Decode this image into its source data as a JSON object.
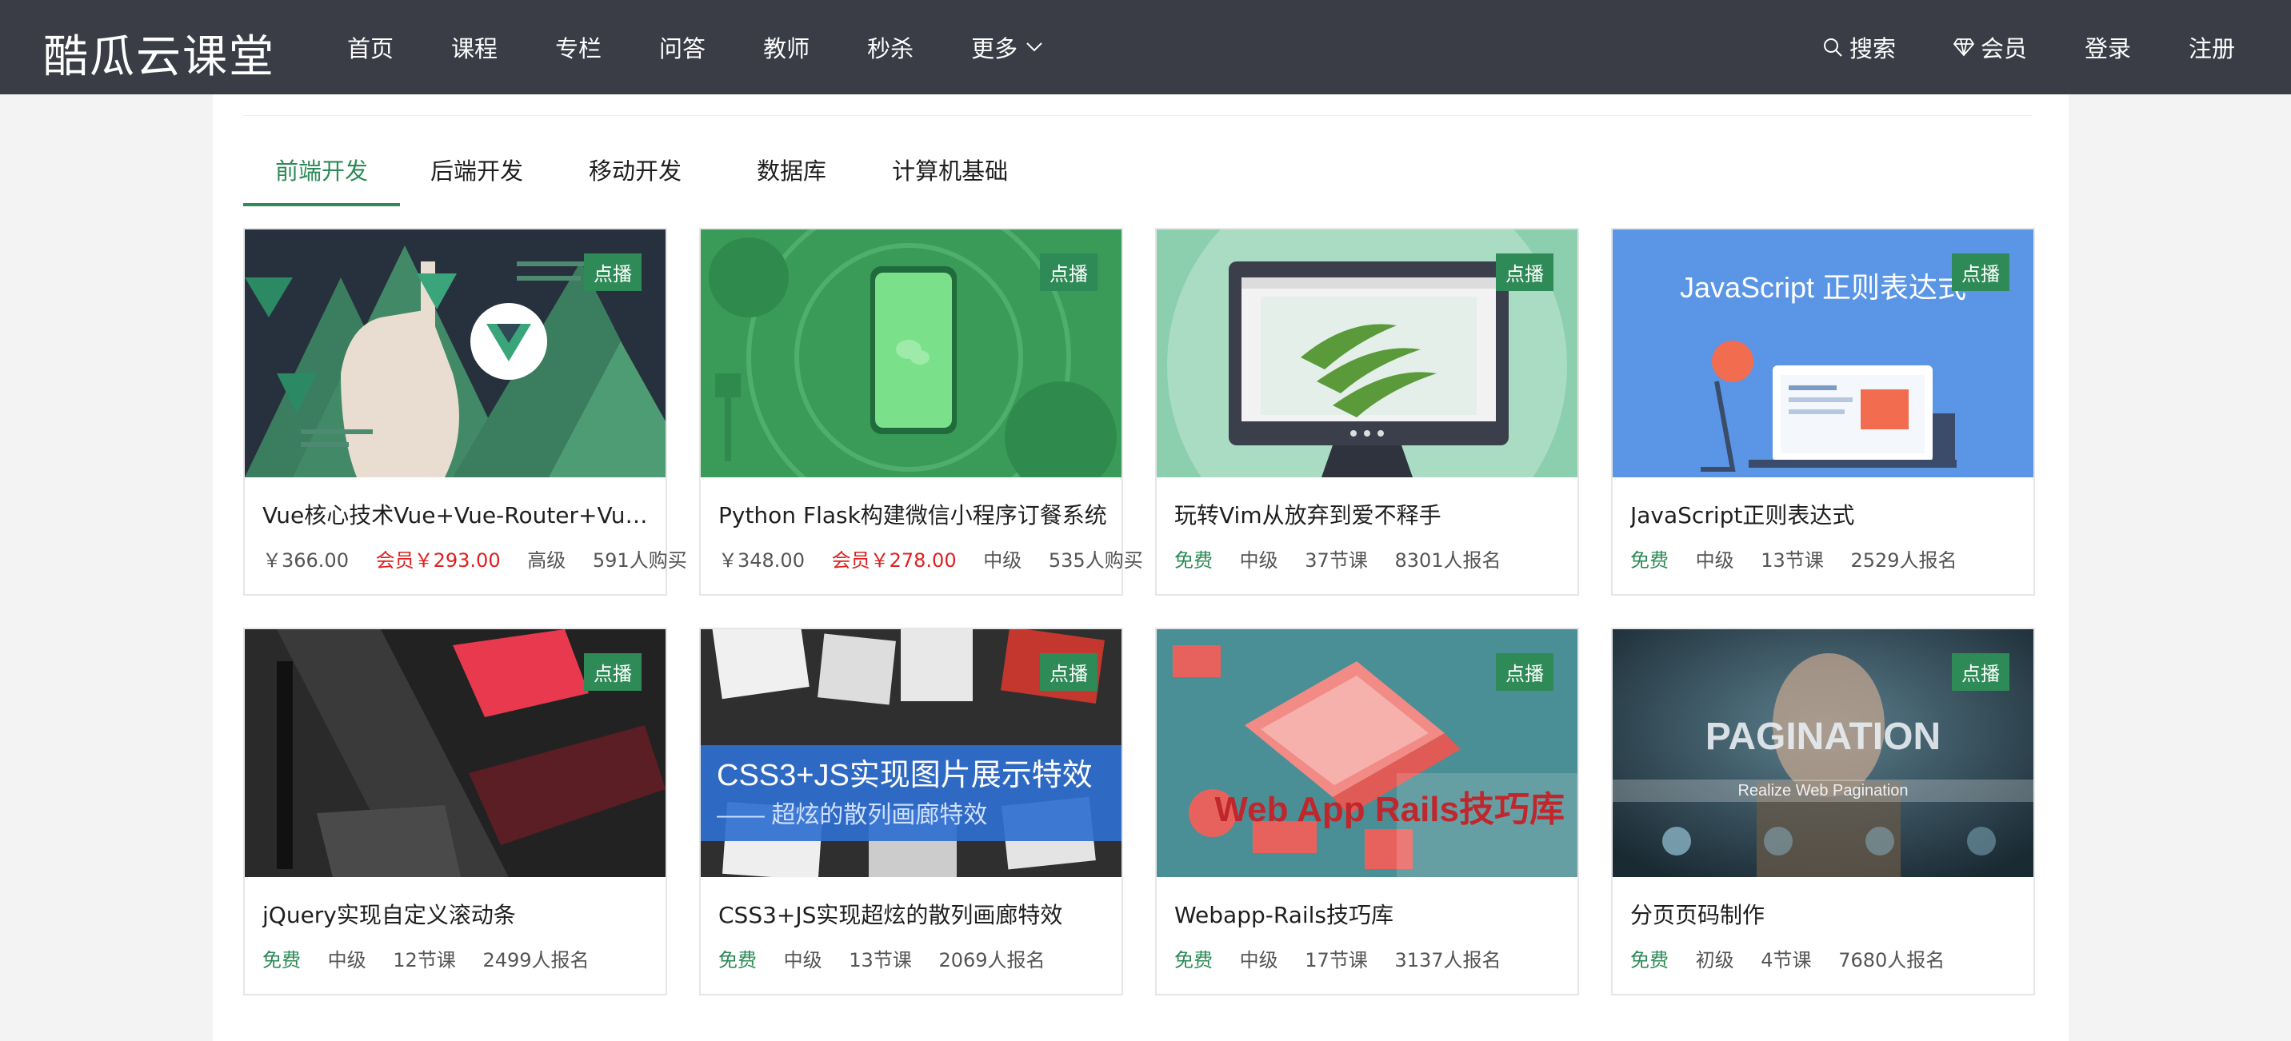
{
  "brand": "酷瓜云课堂",
  "nav": {
    "items": [
      "首页",
      "课程",
      "专栏",
      "问答",
      "教师",
      "秒杀",
      "更多"
    ]
  },
  "header_right": {
    "search": "搜索",
    "member": "会员",
    "login": "登录",
    "register": "注册"
  },
  "tabs": [
    "前端开发",
    "后端开发",
    "移动开发",
    "数据库",
    "计算机基础"
  ],
  "active_tab": "前端开发",
  "courses": [
    {
      "badge": "点播",
      "title": "Vue核心技术Vue+Vue-Router+Vuex+SSR实战精讲",
      "price": "￥366.00",
      "vip": "会员￥293.00",
      "level": "高级",
      "count": "591人购买"
    },
    {
      "badge": "点播",
      "title": "Python Flask构建微信小程序订餐系统",
      "price": "￥348.00",
      "vip": "会员￥278.00",
      "level": "中级",
      "count": "535人购买"
    },
    {
      "badge": "点播",
      "title": "玩转Vim从放弃到爱不释手",
      "price": "免费",
      "level": "中级",
      "lessons": "37节课",
      "count": "8301人报名"
    },
    {
      "badge": "点播",
      "title": "JavaScript正则表达式",
      "price": "免费",
      "level": "中级",
      "lessons": "13节课",
      "count": "2529人报名",
      "image_text": "JavaScript 正则表达式"
    },
    {
      "badge": "点播",
      "title": "jQuery实现自定义滚动条",
      "price": "免费",
      "level": "中级",
      "lessons": "12节课",
      "count": "2499人报名"
    },
    {
      "badge": "点播",
      "title": "CSS3+JS实现超炫的散列画廊特效",
      "price": "免费",
      "level": "中级",
      "lessons": "13节课",
      "count": "2069人报名",
      "image_text": "CSS3+JS实现图片展示特效",
      "image_subtext": "—— 超炫的散列画廊特效"
    },
    {
      "badge": "点播",
      "title": "Webapp-Rails技巧库",
      "price": "免费",
      "level": "中级",
      "lessons": "17节课",
      "count": "3137人报名",
      "image_text": "Web App Rails技巧库"
    },
    {
      "badge": "点播",
      "title": "分页页码制作",
      "price": "免费",
      "level": "初级",
      "lessons": "4节课",
      "count": "7680人报名",
      "image_text": "PAGINATION",
      "image_subtext": "Realize Web Pagination"
    }
  ],
  "colors": {
    "topbar": "#3a3d46",
    "accent": "#2e8b57",
    "vip": "#e02020"
  }
}
